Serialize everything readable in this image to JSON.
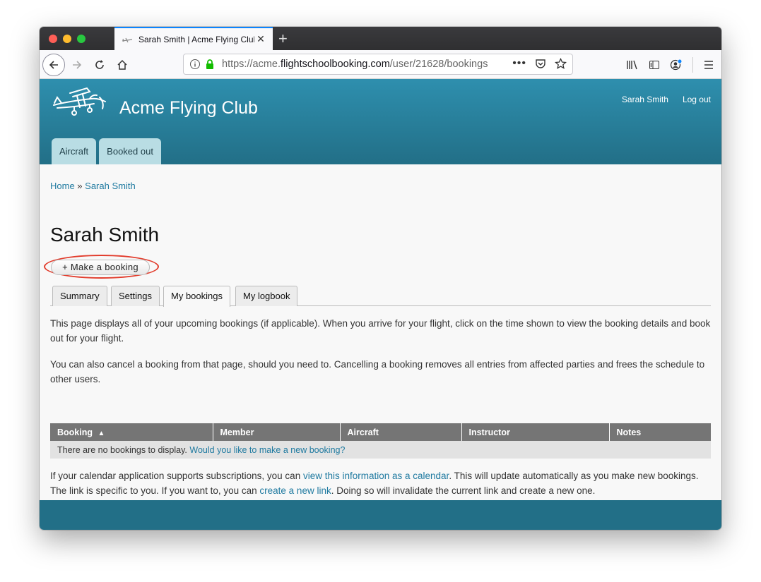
{
  "browser": {
    "tab_title": "Sarah Smith | Acme Flying Club",
    "url_prefix": "https://acme.",
    "url_domain": "flightschoolbooking.com",
    "url_path": "/user/21628/bookings"
  },
  "site": {
    "name": "Acme Flying Club",
    "user_links": {
      "user": "Sarah Smith",
      "logout": "Log out"
    },
    "primary_tabs": [
      "Aircraft",
      "Booked out"
    ]
  },
  "breadcrumb": {
    "home": "Home",
    "separator": " » ",
    "current": "Sarah Smith"
  },
  "page": {
    "title": "Sarah Smith",
    "make_booking": "+ Make a booking",
    "tabs": [
      "Summary",
      "Settings",
      "My bookings",
      "My logbook"
    ],
    "active_tab": "My bookings",
    "intro1": "This page displays all of your upcoming bookings (if applicable). When you arrive for your flight, click on the time shown to view the booking details and book out for your flight.",
    "intro2": "You can also cancel a booking from that page, should you need to. Cancelling a booking removes all entries from affected parties and frees the schedule to other users."
  },
  "table": {
    "columns": [
      "Booking",
      "Member",
      "Aircraft",
      "Instructor",
      "Notes"
    ],
    "sort_indicator": "▲",
    "empty_text": "There are no bookings to display.",
    "empty_link": "Would you like to make a new booking?"
  },
  "calendar": {
    "text1": "If your calendar application supports subscriptions, you can ",
    "link1": "view this information as a calendar",
    "text2": ". This will update automatically as you make new bookings. The link is specific to you. If you want to, you can ",
    "link2": "create a new link",
    "text3": ". Doing so will invalidate the current link and create a new one."
  },
  "colors": {
    "header_top": "#2e8fae",
    "header_bottom": "#226f87",
    "tab_bg": "#b9dde4",
    "link": "#1f7aa0",
    "highlight": "#e23d2d"
  }
}
